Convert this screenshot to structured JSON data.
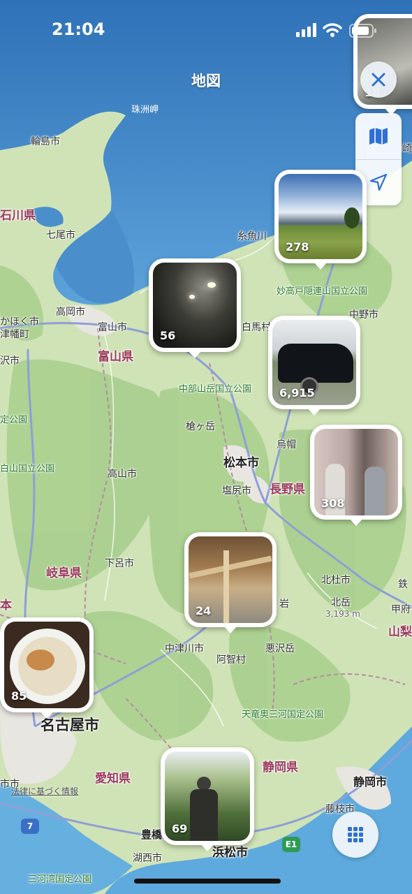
{
  "status": {
    "time": "21:04"
  },
  "title": "地図",
  "map_labels": {
    "suzumisaki": "珠洲岬",
    "wajima": "輪島市",
    "ishikawa": "石川県",
    "nanao": "七尾市",
    "itoigawa": "糸魚川",
    "myoko_park": "妙高戸隠連山国立公園",
    "takaoka": "高岡市",
    "kahoku": "かほく市",
    "tsubata": "津幡町",
    "toyama": "富山市",
    "toyama_pref": "富山県",
    "kanazawa": "沢市",
    "hakuba": "白馬村",
    "nakano": "中野市",
    "chubu_park": "中部山岳国立公園",
    "park_left": "定公園",
    "yarigatake": "槍ヶ岳",
    "karasu": "烏帽",
    "hakusan_park": "白山国立公園",
    "matsumoto": "松本市",
    "takayama": "高山市",
    "shiojiri": "塩尻市",
    "nagano_pref": "長野県",
    "gero": "下呂市",
    "gifu_pref": "岐阜県",
    "hokuto": "北杜市",
    "kitadake": "北岳",
    "kitadake_elev": "3,193 m",
    "kofu": "甲府",
    "yamanashi": "山梨",
    "iwa": "岩",
    "nakatsugawa": "中津川市",
    "achi": "阿智村",
    "warusawa": "悪沢岳",
    "tenryu_park": "天竜奥三河国定公園",
    "nagoya": "名古屋市",
    "shizuoka_pref": "静岡県",
    "aichi_pref": "愛知県",
    "shizuoka": "静岡市",
    "fujieda": "藤枝市",
    "toyohashi": "豊橋",
    "hamamatsu": "浜松市",
    "kosai": "湖西市",
    "mikawa_park": "三河湾国定公園",
    "shi_left": "市市",
    "saki": "崎",
    "kyo": "鉄",
    "route7": "7",
    "e1": "E1",
    "ken_left": "本"
  },
  "legal_link": "法律に基づく情報",
  "photo_pins": [
    {
      "name": "pin-278",
      "count": "278",
      "scene": "sky-field"
    },
    {
      "name": "pin-56",
      "count": "56",
      "scene": "tunnel"
    },
    {
      "name": "pin-6915",
      "count": "6,915",
      "scene": "car"
    },
    {
      "name": "pin-308",
      "count": "308",
      "scene": "hallway"
    },
    {
      "name": "pin-24",
      "count": "24",
      "scene": "timber"
    },
    {
      "name": "pin-85",
      "count": "85",
      "scene": "ramen"
    },
    {
      "name": "pin-69",
      "count": "69",
      "scene": "statue"
    },
    {
      "name": "pin-top",
      "count": "18",
      "scene": "partial"
    }
  ],
  "controls": {
    "close_icon": "close-icon",
    "map_type_icon": "map-icon",
    "location_icon": "location-arrow-icon",
    "grid_icon": "grid-icon"
  },
  "colors": {
    "land": "#cfe3b6",
    "sea": "#4f93cf",
    "forest": "#a9cf8e",
    "accent": "#2f6fd6",
    "prefecture": "#9b3a5c"
  }
}
